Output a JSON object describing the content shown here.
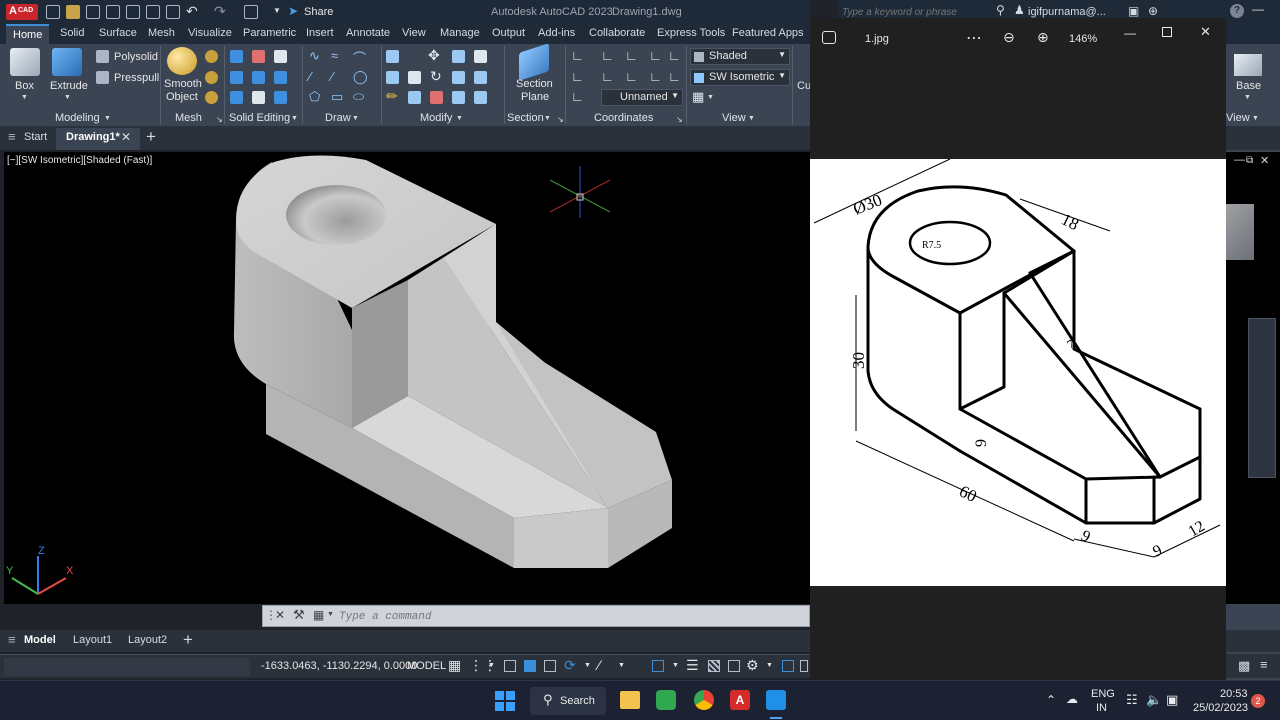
{
  "app_title": "Autodesk AutoCAD 2023",
  "doc_title": "Drawing1.dwg",
  "badge": "CAD",
  "share_label": "Share",
  "search_placeholder": "Type a keyword or phrase",
  "user_name": "igifpurnama@...",
  "ribbon_tabs": [
    "Home",
    "Solid",
    "Surface",
    "Mesh",
    "Visualize",
    "Parametric",
    "Insert",
    "Annotate",
    "View",
    "Manage",
    "Output",
    "Add-ins",
    "Collaborate",
    "Express Tools",
    "Featured Apps"
  ],
  "ribbon": {
    "modeling": {
      "box": "Box",
      "extrude": "Extrude",
      "polysolid": "Polysolid",
      "presspull": "Presspull",
      "title": "Modeling"
    },
    "mesh": {
      "smooth": "Smooth",
      "object": "Object",
      "title": "Mesh"
    },
    "solid_editing_title": "Solid Editing",
    "draw_title": "Draw",
    "modify_title": "Modify",
    "section": {
      "section": "Section",
      "plane": "Plane",
      "title": "Section"
    },
    "coordinates_title": "Coordinates",
    "view": {
      "visual_style": "Shaded",
      "view_direction": "SW Isometric",
      "named_view": "Unnamed",
      "title": "View"
    },
    "cu": "Cu",
    "base": "Base",
    "view_right": "View"
  },
  "doc_tabs": {
    "start": "Start",
    "drawing": "Drawing1*"
  },
  "viewport_label": "[−][SW Isometric][Shaded (Fast)]",
  "command_placeholder": "Type a command",
  "layout_tabs": [
    "Model",
    "Layout1",
    "Layout2"
  ],
  "status": {
    "coords": "-1633.0463, -1130.2294, 0.0000",
    "model": "MODEL"
  },
  "viewer": {
    "filename": "1.jpg",
    "zoom": "146%"
  },
  "drawing_dims": {
    "dia": "Ø30",
    "radius": "R7.5",
    "d18": "18",
    "d30": "30",
    "d7": "7",
    "d9a": "9",
    "d60": "60",
    "d9b": "9",
    "d9c": "9",
    "d12": "12"
  },
  "taskbar": {
    "search": "Search",
    "lang1": "ENG",
    "lang2": "IN",
    "time": "20:53",
    "date": "25/02/2023",
    "notif": "2"
  },
  "colors": {
    "accent": "#3a8fd8",
    "autocad_red": "#d62b2b",
    "ribbon_bg": "#3b4453",
    "title_bg": "#1e2a38"
  }
}
